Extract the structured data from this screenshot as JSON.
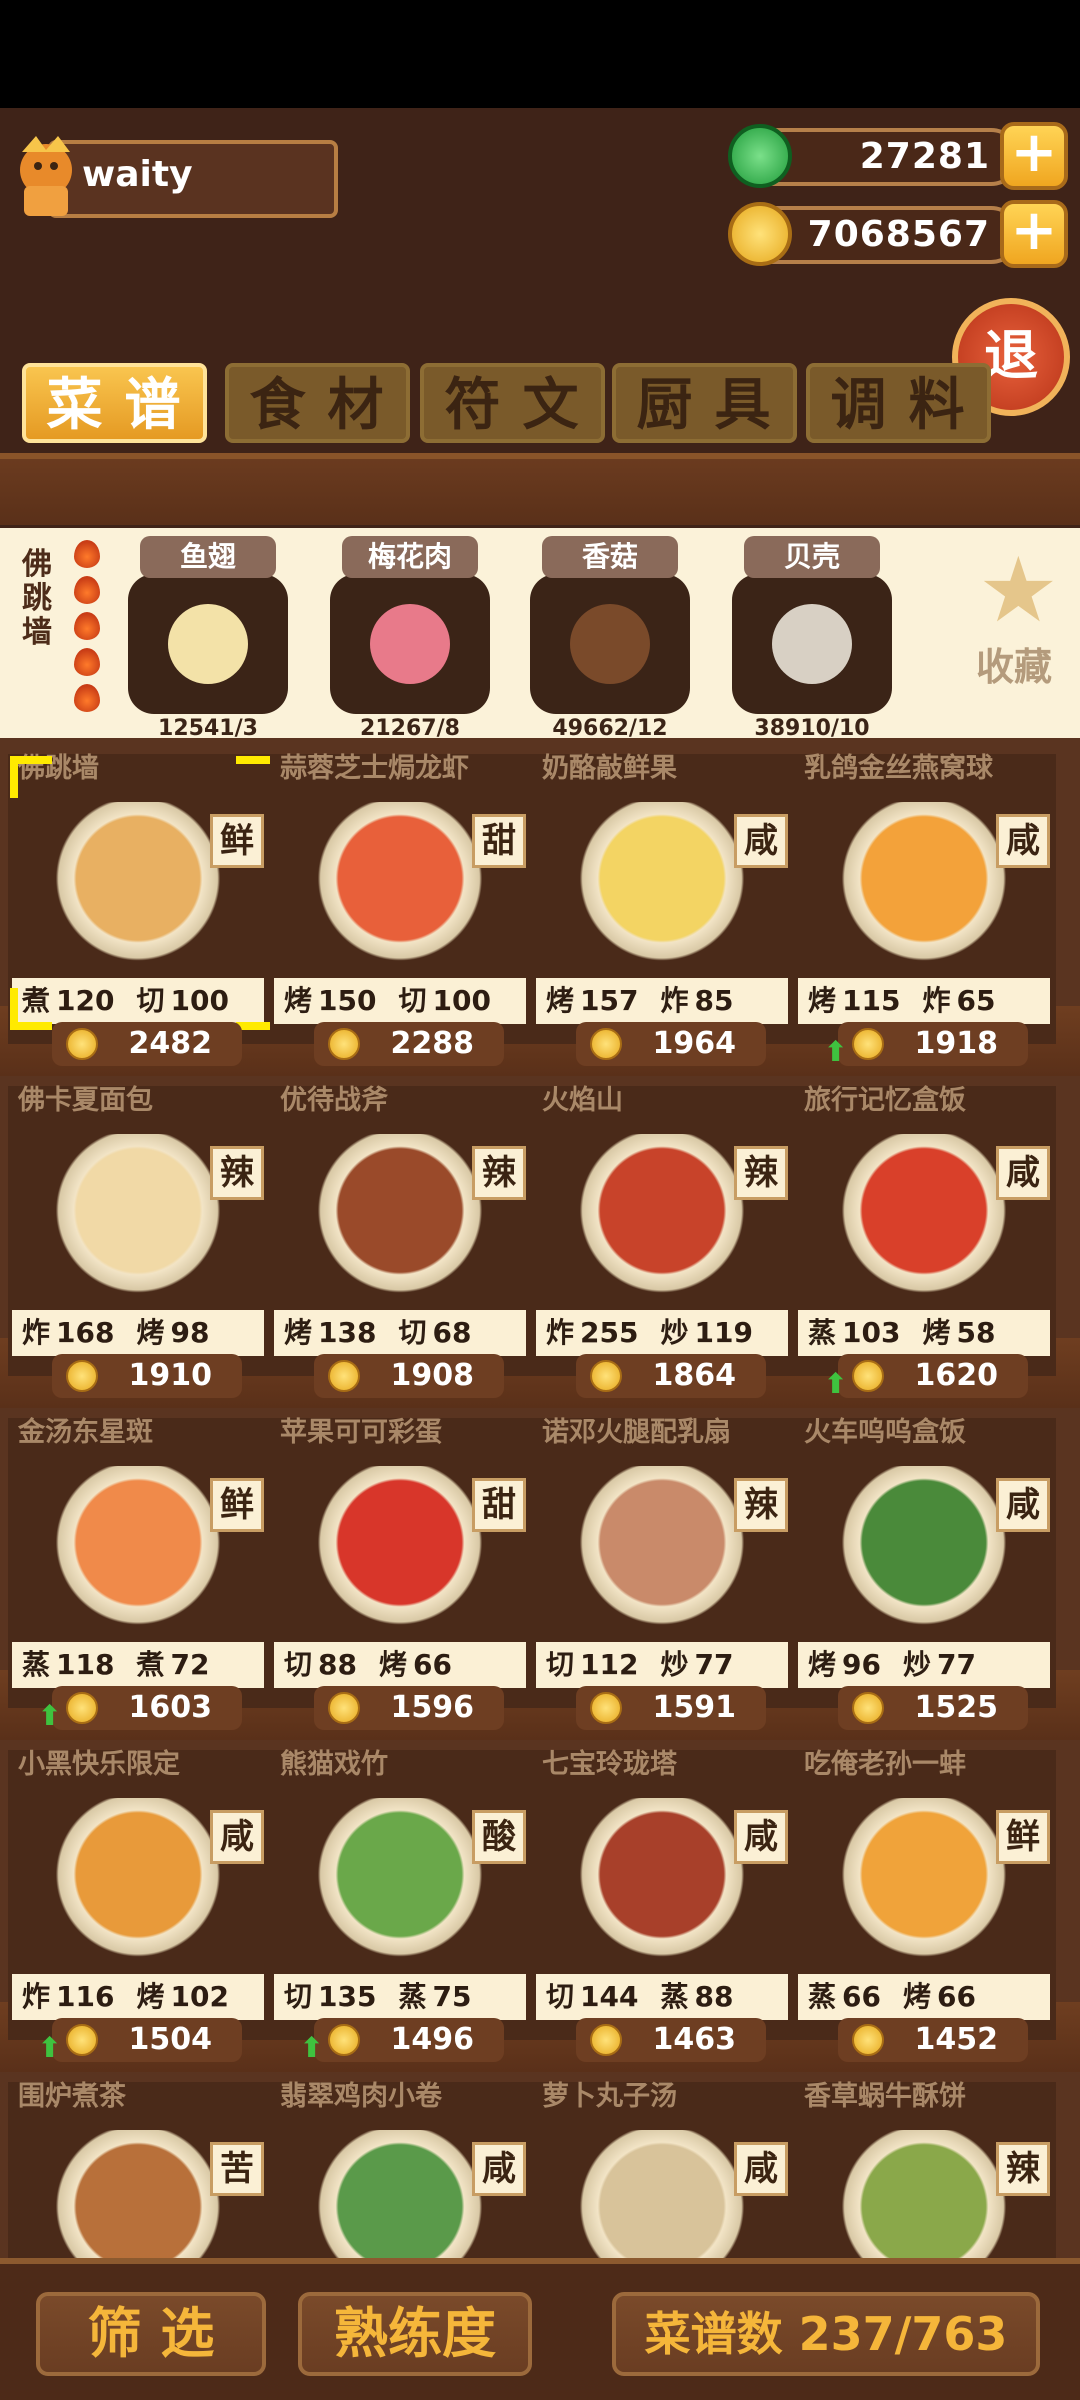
{
  "player": {
    "name": "waity"
  },
  "currency": {
    "jade": "27281",
    "coins": "7068567"
  },
  "exit_label": "退",
  "tabs": [
    {
      "label": "菜谱",
      "active": true
    },
    {
      "label": "食材",
      "active": false
    },
    {
      "label": "符文",
      "active": false
    },
    {
      "label": "厨具",
      "active": false
    },
    {
      "label": "调料",
      "active": false
    }
  ],
  "selected_dish": {
    "name": "佛跳墙",
    "flame_count": 5,
    "ingredients": [
      {
        "name": "鱼翅",
        "qty": "12541/3"
      },
      {
        "name": "梅花肉",
        "qty": "21267/8"
      },
      {
        "name": "香菇",
        "qty": "49662/12"
      },
      {
        "name": "贝壳",
        "qty": "38910/10"
      }
    ],
    "favorite_label": "收藏"
  },
  "recipes": [
    {
      "name": "佛跳墙",
      "taste": "鲜",
      "stats": [
        [
          "煮",
          "120"
        ],
        [
          "切",
          "100"
        ]
      ],
      "price": "2482",
      "up": false,
      "selected": true,
      "color": "#e8b062"
    },
    {
      "name": "蒜蓉芝士焗龙虾",
      "taste": "甜",
      "stats": [
        [
          "烤",
          "150"
        ],
        [
          "切",
          "100"
        ]
      ],
      "price": "2288",
      "up": false,
      "color": "#e8603a"
    },
    {
      "name": "奶酪敲鲜果",
      "taste": "咸",
      "stats": [
        [
          "烤",
          "157"
        ],
        [
          "炸",
          "85"
        ]
      ],
      "price": "1964",
      "up": false,
      "color": "#f3d463"
    },
    {
      "name": "乳鸽金丝燕窝球",
      "taste": "咸",
      "stats": [
        [
          "烤",
          "115"
        ],
        [
          "炸",
          "65"
        ]
      ],
      "price": "1918",
      "up": true,
      "color": "#f3a23a"
    },
    {
      "name": "佛卡夏面包",
      "taste": "辣",
      "stats": [
        [
          "炸",
          "168"
        ],
        [
          "烤",
          "98"
        ]
      ],
      "price": "1910",
      "up": false,
      "color": "#f1d9a6"
    },
    {
      "name": "优待战斧",
      "taste": "辣",
      "stats": [
        [
          "烤",
          "138"
        ],
        [
          "切",
          "68"
        ]
      ],
      "price": "1908",
      "up": false,
      "color": "#9a4a2a"
    },
    {
      "name": "火焰山",
      "taste": "辣",
      "stats": [
        [
          "炸",
          "255"
        ],
        [
          "炒",
          "119"
        ]
      ],
      "price": "1864",
      "up": false,
      "color": "#c8432a"
    },
    {
      "name": "旅行记忆盒饭",
      "taste": "咸",
      "stats": [
        [
          "蒸",
          "103"
        ],
        [
          "烤",
          "58"
        ]
      ],
      "price": "1620",
      "up": true,
      "color": "#d9402a"
    },
    {
      "name": "金汤东星斑",
      "taste": "鲜",
      "stats": [
        [
          "蒸",
          "118"
        ],
        [
          "煮",
          "72"
        ]
      ],
      "price": "1603",
      "up": true,
      "color": "#f08a4a"
    },
    {
      "name": "苹果可可彩蛋",
      "taste": "甜",
      "stats": [
        [
          "切",
          "88"
        ],
        [
          "烤",
          "66"
        ]
      ],
      "price": "1596",
      "up": false,
      "color": "#d8362a"
    },
    {
      "name": "诺邓火腿配乳扇",
      "taste": "辣",
      "stats": [
        [
          "切",
          "112"
        ],
        [
          "炒",
          "77"
        ]
      ],
      "price": "1591",
      "up": false,
      "color": "#c98a6a"
    },
    {
      "name": "火车呜呜盒饭",
      "taste": "咸",
      "stats": [
        [
          "烤",
          "96"
        ],
        [
          "炒",
          "77"
        ]
      ],
      "price": "1525",
      "up": false,
      "color": "#4a8a3a"
    },
    {
      "name": "小黑快乐限定",
      "taste": "咸",
      "stats": [
        [
          "炸",
          "116"
        ],
        [
          "烤",
          "102"
        ]
      ],
      "price": "1504",
      "up": true,
      "color": "#e89a3a"
    },
    {
      "name": "熊猫戏竹",
      "taste": "酸",
      "stats": [
        [
          "切",
          "135"
        ],
        [
          "蒸",
          "75"
        ]
      ],
      "price": "1496",
      "up": true,
      "color": "#6aa84a"
    },
    {
      "name": "七宝玲珑塔",
      "taste": "咸",
      "stats": [
        [
          "切",
          "144"
        ],
        [
          "蒸",
          "88"
        ]
      ],
      "price": "1463",
      "up": false,
      "color": "#a8402a"
    },
    {
      "name": "吃俺老孙一蚌",
      "taste": "鲜",
      "stats": [
        [
          "蒸",
          "66"
        ],
        [
          "烤",
          "66"
        ]
      ],
      "price": "1452",
      "up": false,
      "color": "#f0a33a"
    },
    {
      "name": "围炉煮茶",
      "taste": "苦",
      "color": "#b8703a"
    },
    {
      "name": "翡翠鸡肉小卷",
      "taste": "咸",
      "color": "#5a9a4a"
    },
    {
      "name": "萝卜丸子汤",
      "taste": "咸",
      "color": "#d8c39a"
    },
    {
      "name": "香草蜗牛酥饼",
      "taste": "辣",
      "color": "#8aa84a"
    }
  ],
  "bottom": {
    "filter_label": "筛 选",
    "proficiency_label": "熟练度",
    "count_label": "菜谱数 237/763"
  }
}
